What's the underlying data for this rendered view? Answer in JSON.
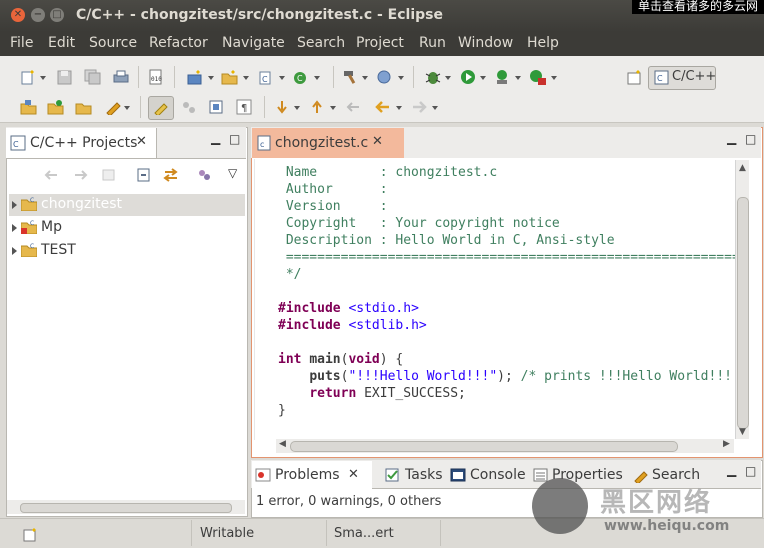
{
  "window": {
    "title": "C/C++ - chongzitest/src/chongzitest.c - Eclipse"
  },
  "ime_popup": {
    "text": "单击查看诸多的多云网"
  },
  "menu": [
    "File",
    "Edit",
    "Source",
    "Refactor",
    "Navigate",
    "Search",
    "Project",
    "Run",
    "Window",
    "Help"
  ],
  "perspective": {
    "label": "C/C++"
  },
  "project_view": {
    "title": "C/C++ Projects",
    "items": [
      {
        "label": "chongzitest",
        "selected": true
      },
      {
        "label": "Mp",
        "selected": false
      },
      {
        "label": "TEST",
        "selected": false
      }
    ]
  },
  "editor": {
    "tab_label": "chongzitest.c",
    "code": [
      " Name        : chongzitest.c",
      " Author      :",
      " Version     :",
      " Copyright   : Your copyright notice",
      " Description : Hello World in C, Ansi-style",
      " ============================================================================",
      " */",
      "",
      "#include <stdio.h>",
      "#include <stdlib.h>",
      "",
      "int main(void) {",
      "    puts(\"!!!Hello World!!!\"); /* prints !!!Hello World!!! */",
      "    return EXIT_SUCCESS;",
      "}"
    ]
  },
  "bottom_panel": {
    "tabs": [
      "Problems",
      "Tasks",
      "Console",
      "Properties",
      "Search"
    ],
    "summary": "1 error, 0 warnings, 0 others"
  },
  "status": {
    "writable": "Writable",
    "insert_mode": "Sma...ert"
  },
  "watermark": {
    "title": "黑区网络",
    "url": "www.heiqu.com"
  }
}
